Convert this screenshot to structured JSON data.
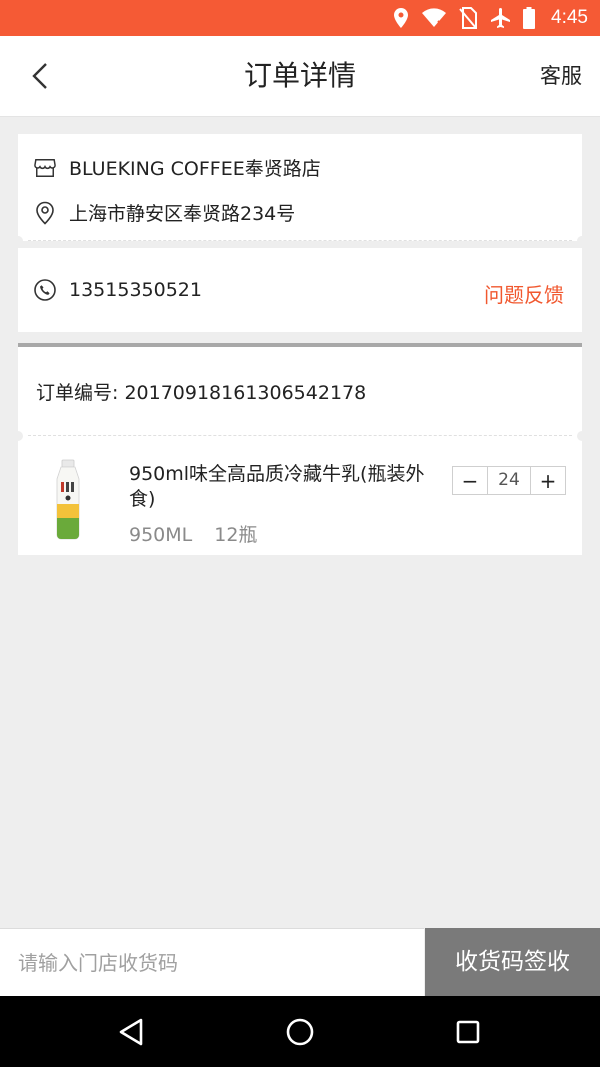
{
  "status_bar": {
    "time": "4:45",
    "icons": [
      "location-icon",
      "wifi-icon",
      "no-sim-icon",
      "airplane-icon",
      "battery-icon"
    ],
    "background_color": "#f55a35"
  },
  "header": {
    "title": "订单详情",
    "right_action": "客服",
    "back_icon": "chevron-left-icon"
  },
  "store": {
    "name": "BLUEKING COFFEE奉贤路店",
    "address": "上海市静安区奉贤路234号",
    "store_icon": "store-icon",
    "location_icon": "location-pin-icon"
  },
  "contact": {
    "phone": "13515350521",
    "phone_icon": "phone-icon",
    "feedback_label": "问题反馈",
    "feedback_color": "#f1582f"
  },
  "order": {
    "number_text": "订单编号: 20170918161306542178"
  },
  "product": {
    "name": "950ml味全高品质冷藏牛乳(瓶装外食)",
    "spec": "950ML",
    "count": "12瓶",
    "quantity": "24",
    "minus_label": "−",
    "plus_label": "+",
    "image_icon": "milk-bottle-icon"
  },
  "footer": {
    "input_placeholder": "请输入门店收货码",
    "submit_label": "收货码签收",
    "submit_color": "#7a7a7a"
  },
  "nav_bar": {
    "icons": [
      "back-triangle-icon",
      "home-circle-icon",
      "recents-square-icon"
    ]
  }
}
